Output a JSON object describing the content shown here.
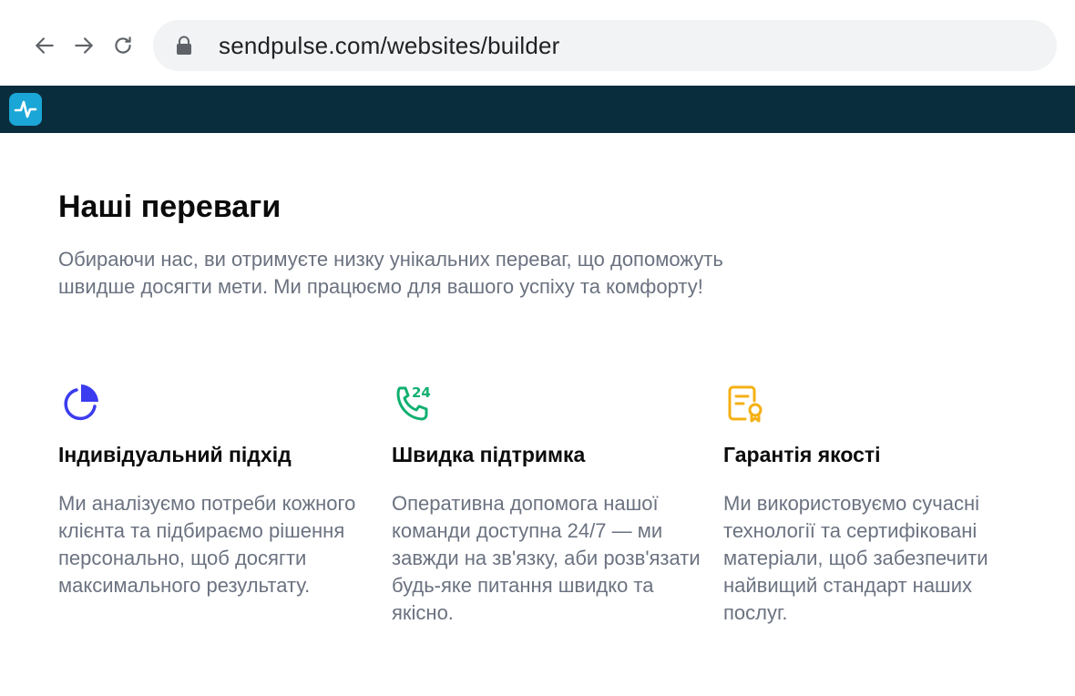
{
  "browser": {
    "url": "sendpulse.com/websites/builder",
    "icons": [
      "back-arrow-icon",
      "forward-arrow-icon",
      "reload-icon",
      "lock-icon"
    ]
  },
  "app": {
    "logo_icon": "pulse-logo-icon",
    "colors": {
      "header_bg": "#0a2d3d",
      "logo_bg": "#1aa6d6"
    }
  },
  "section": {
    "title": "Наші переваги",
    "subtitle": "Обираючи нас, ви отримуєте низку унікальних переваг, що допоможуть швидше досягти мети. Ми працюємо для вашого успіху та комфорту!"
  },
  "features": [
    {
      "icon": "pie-chart-icon",
      "color": "#3b3bf0",
      "title": "Індивідуальний підхід",
      "description": "Ми аналізуємо потреби кожного клієнта та підбираємо рішення персонально, щоб досягти максимального результату."
    },
    {
      "icon": "phone-24-icon",
      "color": "#10b070",
      "title": "Швидка підтримка",
      "description": "Оперативна допомога нашої команди доступна 24/7 — ми завжди на зв'язку, аби розв'язати будь-яке питання швидко та якісно."
    },
    {
      "icon": "certificate-icon",
      "color": "#f5b014",
      "title": "Гарантія якості",
      "description": "Ми використовуємо сучасні технології та сертифіковані матеріали, щоб забезпечити найвищий стандарт наших послуг."
    }
  ],
  "phone_badge": "24"
}
